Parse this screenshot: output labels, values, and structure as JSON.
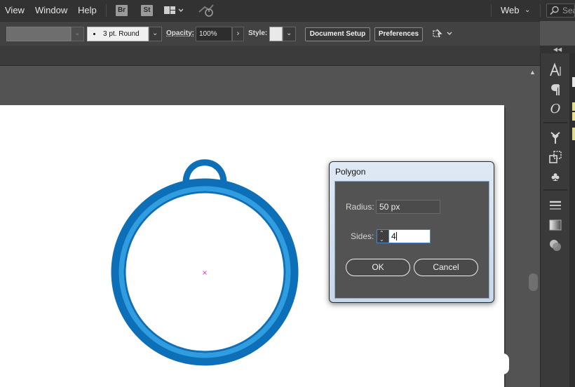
{
  "menubar": {
    "items": [
      "View",
      "Window",
      "Help"
    ],
    "bridge_label": "Br",
    "stock_label": "St",
    "workspace": "Web",
    "search_placeholder": "Sea"
  },
  "controlbar": {
    "brush_label": "3 pt. Round",
    "opacity_label": "Opacity:",
    "opacity_value": "100%",
    "style_label": "Style:",
    "document_setup": "Document Setup",
    "preferences": "Preferences"
  },
  "dialog": {
    "title": "Polygon",
    "radius_label": "Radius:",
    "radius_value": "50 px",
    "sides_label": "Sides:",
    "sides_value": "4",
    "ok_label": "OK",
    "cancel_label": "Cancel"
  },
  "dock": {
    "icons": [
      "character-icon",
      "paragraph-icon",
      "opentype-icon",
      "symbols-icon",
      "transform-icon",
      "club-icon",
      "stroke-icon",
      "gradient-icon",
      "transparency-icon"
    ]
  },
  "colors": {
    "ring_outer": "#0d6fb8",
    "ring_inner": "#2f9de0",
    "center_mark": "#d94fd1",
    "dialog_focus": "#4f84c6"
  }
}
